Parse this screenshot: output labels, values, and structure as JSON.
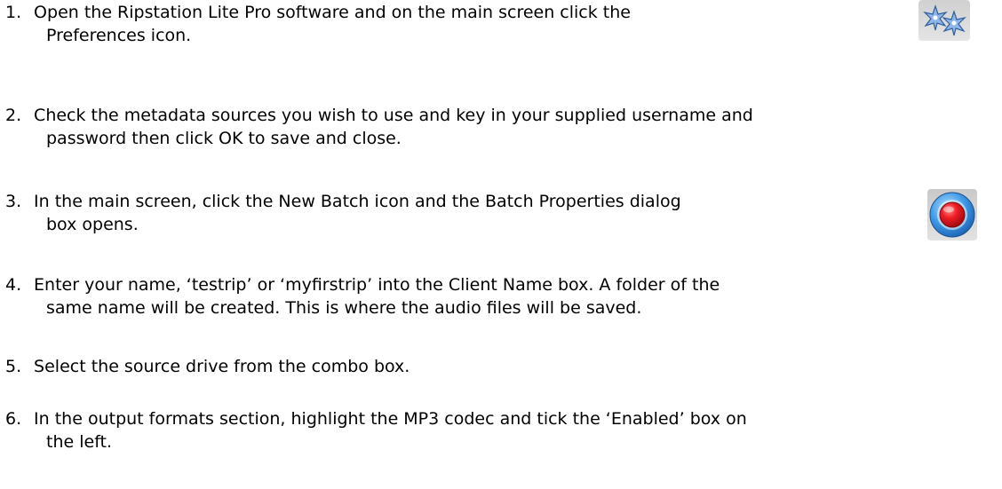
{
  "steps": [
    {
      "number": "1.",
      "line1": "Open the Ripstation Lite Pro software and on the main screen click the",
      "line2": "Preferences icon."
    },
    {
      "number": "2.",
      "line1": "Check the metadata sources you wish to use and key in your supplied username and",
      "line2": "password then click OK to save and close."
    },
    {
      "number": "3.",
      "line1": "In the main screen, click the New Batch icon and the Batch Properties dialog",
      "line2": "box opens."
    },
    {
      "number": "4.",
      "line1": "Enter your name, ‘testrip’ or ‘myfirstrip’ into the Client Name box.  A folder of the",
      "line2": "same name will be created.  This is where the audio files will be saved."
    },
    {
      "number": "5.",
      "line1": "Select the source drive from the combo box.",
      "line2": ""
    },
    {
      "number": "6.",
      "line1": "In the output formats section, highlight the MP3 codec and tick the ‘Enabled’ box on",
      "line2": "the left."
    }
  ],
  "icons": {
    "preferences": "preferences-icon",
    "new_batch": "new-batch-record-icon"
  },
  "colors": {
    "text": "#000000",
    "record_red": "#e8141e",
    "record_ring_blue": "#2f8fe0",
    "snowflake_blue": "#5b8fd0"
  }
}
